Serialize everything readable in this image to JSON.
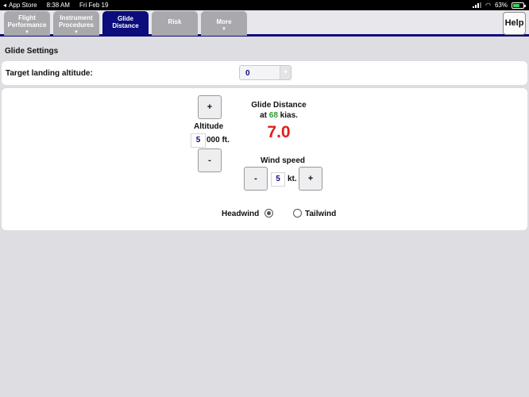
{
  "status": {
    "back_app": "App Store",
    "time": "8:38 AM",
    "date": "Fri Feb 19",
    "battery": "63%",
    "battery_level": 0.63
  },
  "tabs": [
    {
      "line1": "Flight",
      "line2": "Performance",
      "active": false,
      "has_menu": true
    },
    {
      "line1": "Instrument",
      "line2": "Procedures",
      "active": false,
      "has_menu": true
    },
    {
      "line1": "Glide",
      "line2": "Distance",
      "active": true,
      "has_menu": false
    },
    {
      "line1": "Risk",
      "line2": "",
      "active": false,
      "has_menu": false
    },
    {
      "line1": "More",
      "line2": "",
      "active": false,
      "has_menu": true
    }
  ],
  "help_label": "Help",
  "section_title": "Glide Settings",
  "landing": {
    "label": "Target landing altitude:",
    "value": "0"
  },
  "altitude": {
    "plus": "+",
    "minus": "-",
    "label": "Altitude",
    "digit": "5",
    "rest": "000 ft."
  },
  "glide": {
    "title": "Glide Distance",
    "at": "at",
    "speed": "68",
    "speed_unit": "kias.",
    "value": "7.0"
  },
  "wind": {
    "label": "Wind speed",
    "minus": "-",
    "plus": "+",
    "value": "5",
    "unit": "kt."
  },
  "direction": {
    "headwind": "Headwind",
    "tailwind": "Tailwind",
    "selected": "headwind"
  },
  "colors": {
    "accent": "#0c0c7c",
    "result": "#e0201a",
    "speed": "#2e9a2e"
  }
}
